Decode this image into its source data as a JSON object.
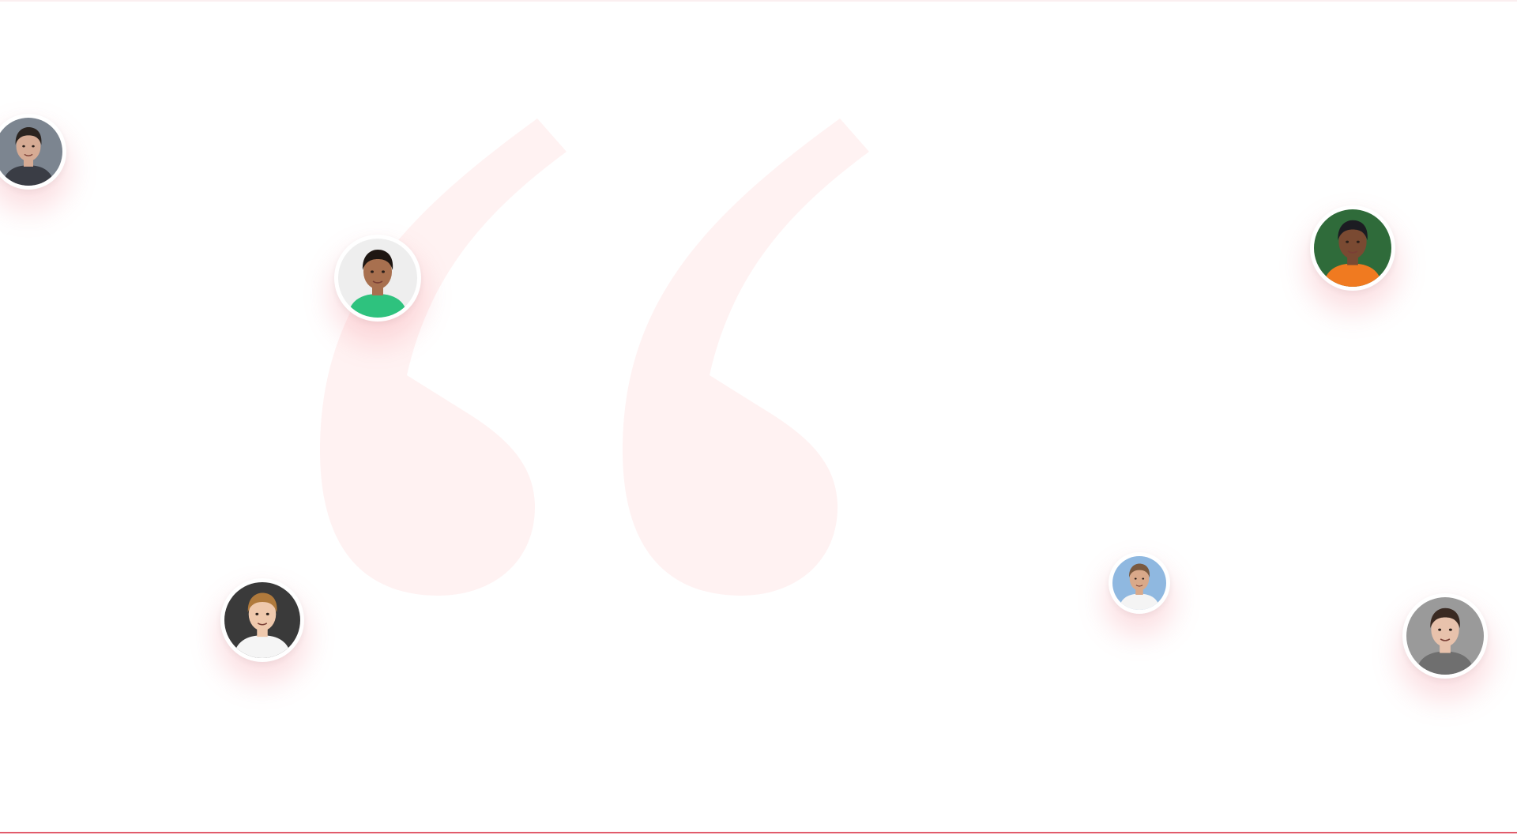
{
  "theme": {
    "accent": "#e15b6b",
    "quote_tint": "#fff2f2",
    "glow": "rgba(240, 120, 130, 0.22)",
    "top_rule": "#fbeff0"
  },
  "decor": {
    "quote_icon": "opening-quote-mark-icon"
  },
  "avatars": [
    {
      "id": "avatar-1",
      "icon": "person-portrait",
      "skin": "#d6ab94",
      "hair": "#2b2420",
      "shirt": "#3a3d45",
      "bg": "#7c8590"
    },
    {
      "id": "avatar-2",
      "icon": "person-portrait",
      "skin": "#a8704f",
      "hair": "#1e1612",
      "shirt": "#2ec27e",
      "bg": "#eeeeee"
    },
    {
      "id": "avatar-3",
      "icon": "person-portrait",
      "skin": "#7a4a32",
      "hair": "#1c1c22",
      "shirt": "#f07a20",
      "bg": "#2f6b3a"
    },
    {
      "id": "avatar-4",
      "icon": "person-portrait",
      "skin": "#efc9ad",
      "hair": "#b07a3c",
      "shirt": "#f5f5f5",
      "bg": "#3a3a3a"
    },
    {
      "id": "avatar-5",
      "icon": "person-portrait",
      "skin": "#d9a98a",
      "hair": "#7a5a40",
      "shirt": "#f4f4f4",
      "bg": "#8fb8e0"
    },
    {
      "id": "avatar-6",
      "icon": "person-portrait",
      "skin": "#e8c2ac",
      "hair": "#3a2a22",
      "shirt": "#6f6f6f",
      "bg": "#9a9a9a"
    }
  ]
}
